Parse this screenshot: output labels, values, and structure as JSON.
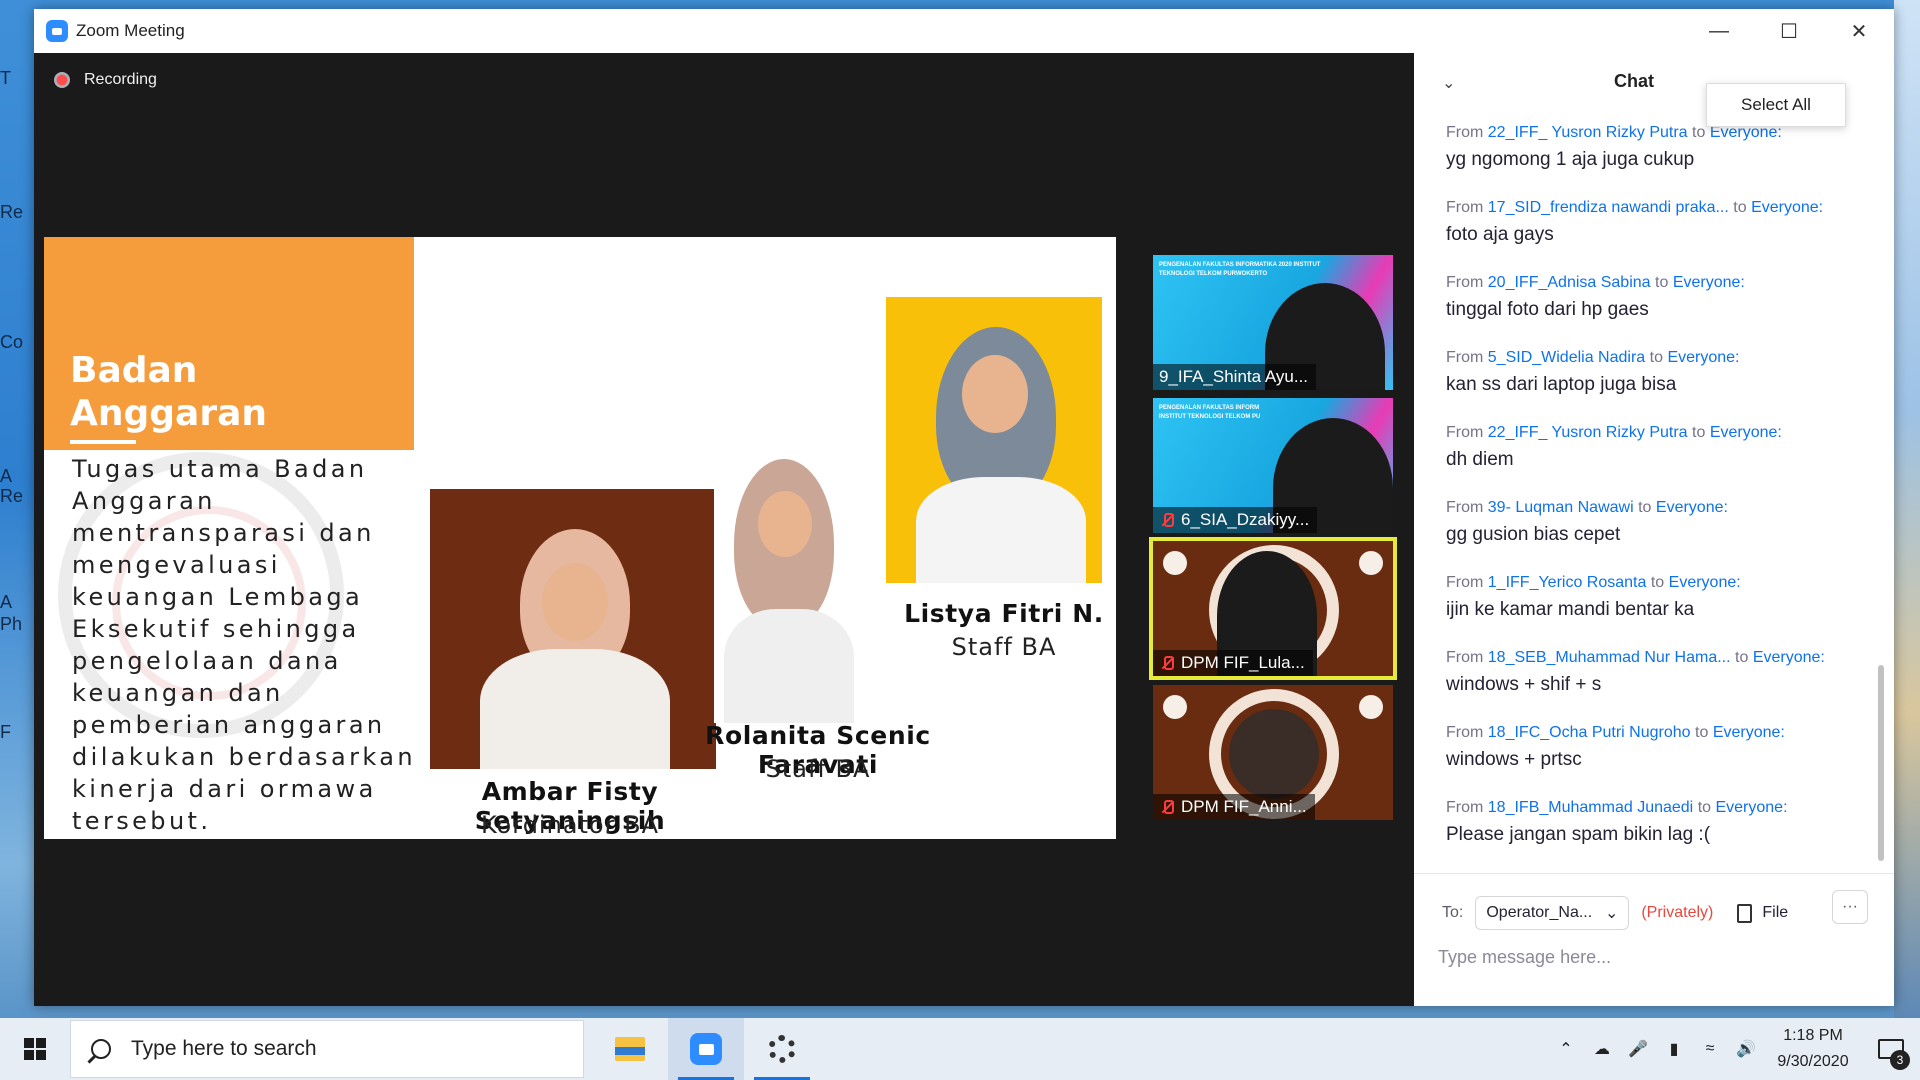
{
  "window": {
    "title": "Zoom Meeting",
    "minimize": "—",
    "maximize": "☐",
    "close": "✕"
  },
  "desktop_left_fragments": [
    "T",
    "Re",
    "Co",
    "A",
    "Re",
    "A",
    "Ph",
    "F"
  ],
  "recording_label": "Recording",
  "slide": {
    "title": "Badan Anggaran",
    "body": "Tugas utama Badan Anggaran mentransparasi dan mengevaluasi keuangan Lembaga Eksekutif sehingga pengelolaan dana keuangan dan pemberian anggaran dilakukan berdasarkan kinerja dari ormawa tersebut.",
    "members": [
      {
        "name": "Ambar Fisty Setyaningsih",
        "role": "Kordinator BA"
      },
      {
        "name": "Rolanita Scenic Faravati",
        "role": "Staff BA"
      },
      {
        "name": "Listya Fitri N.",
        "role": "Staff BA"
      }
    ]
  },
  "participants": [
    {
      "name": "9_IFA_Shinta Ayu...",
      "muted": false,
      "style": "blue",
      "banner": "PENGENALAN FAKULTAS INFORMATIKA 2020 INSTITUT TEKNOLOGI TELKOM PURWOKERTO"
    },
    {
      "name": "6_SIA_Dzakiyy...",
      "muted": true,
      "style": "blue",
      "banner": "PENGENALAN FAKULTAS INFORM INSTITUT TEKNOLOGI TELKOM PU"
    },
    {
      "name": "DPM FIF_Lula...",
      "muted": true,
      "style": "brown",
      "active": true
    },
    {
      "name": "DPM FIF_Anni...",
      "muted": true,
      "style": "brown"
    }
  ],
  "chat": {
    "title": "Chat",
    "popup": "Select All",
    "messages": [
      {
        "from": "22_IFF_ Yusron Rizky Putra",
        "to": "Everyone:",
        "text": "yg ngomong 1 aja juga cukup"
      },
      {
        "from": "17_SID_frendiza nawandi praka...",
        "to": "Everyone:",
        "text": "foto aja gays"
      },
      {
        "from": "20_IFF_Adnisa Sabina",
        "to": "Everyone:",
        "text": "tinggal foto dari hp gaes"
      },
      {
        "from": "5_SID_Widelia Nadira",
        "to": "Everyone:",
        "text": "kan ss dari laptop juga bisa"
      },
      {
        "from": "22_IFF_ Yusron Rizky Putra",
        "to": "Everyone:",
        "text": "dh diem"
      },
      {
        "from": "39- Luqman Nawawi",
        "to": "Everyone:",
        "text": "gg gusion bias cepet"
      },
      {
        "from": "1_IFF_Yerico Rosanta",
        "to": "Everyone:",
        "text": "ijin ke kamar mandi bentar ka"
      },
      {
        "from": "18_SEB_Muhammad Nur Hama...",
        "to": "Everyone:",
        "text": "windows + shif + s"
      },
      {
        "from": "18_IFC_Ocha Putri Nugroho",
        "to": "Everyone:",
        "text": "windows + prtsc"
      },
      {
        "from": "18_IFB_Muhammad Junaedi",
        "to": "Everyone:",
        "text": "Please jangan spam bikin lag :("
      }
    ],
    "from_word": "From",
    "to_word": "to",
    "to_label": "To:",
    "recipient": "Operator_Na...",
    "privately": "(Privately)",
    "file_label": "File",
    "more": "···",
    "input_placeholder": "Type message here..."
  },
  "taskbar": {
    "search_placeholder": "Type here to search",
    "apps": [
      "file-explorer",
      "zoom",
      "settings"
    ],
    "time": "1:18 PM",
    "date": "9/30/2020",
    "notification_count": "3"
  }
}
